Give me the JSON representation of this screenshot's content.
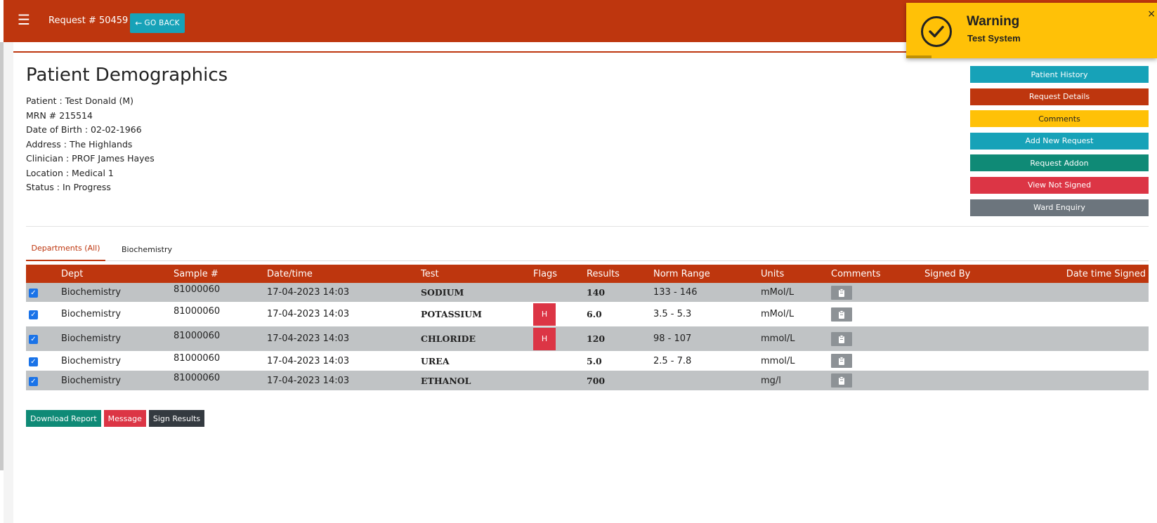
{
  "header": {
    "menu_icon": "hamburger-icon",
    "request_title": "Request # 50459",
    "go_back_label": "GO BACK",
    "go_back_icon": "arrow-left-icon"
  },
  "demographics": {
    "title": "Patient Demographics",
    "lines": [
      "Patient : Test Donald (M)",
      "MRN # 215514",
      "Date of Birth : 02-02-1966",
      "Address : The Highlands",
      "Clinician : PROF James Hayes",
      "Location : Medical 1",
      "Status : In Progress"
    ]
  },
  "side_buttons": [
    {
      "label": "Patient History",
      "color": "#17a2b8"
    },
    {
      "label": "Request Details",
      "color": "#be360e"
    },
    {
      "label": "Comments",
      "color": "#ffc107"
    },
    {
      "label": "Add New Request",
      "color": "#17a2b8"
    },
    {
      "label": "Request Addon",
      "color": "#0f8a76"
    },
    {
      "label": "View Not Signed",
      "color": "#dc3545"
    },
    {
      "label": "Ward Enquiry",
      "color": "#6c757d"
    }
  ],
  "tabs": [
    {
      "label": "Departments (All)",
      "active": true
    },
    {
      "label": "Biochemistry",
      "active": false
    }
  ],
  "table": {
    "headers": [
      "Dept",
      "Sample #",
      "Date/time",
      "Test",
      "Flags",
      "Results",
      "Norm Range",
      "Units",
      "Comments",
      "Signed By",
      "Date time Signed"
    ],
    "rows": [
      {
        "checked": true,
        "dept": "Biochemistry",
        "sample": "81000060",
        "datetime": "17-04-2023 14:03",
        "test": "SODIUM",
        "flag": "",
        "result": "140",
        "range": "133 - 146",
        "units": "mMol/L",
        "signed_by": "",
        "signed_at": ""
      },
      {
        "checked": true,
        "dept": "Biochemistry",
        "sample": "81000060",
        "datetime": "17-04-2023 14:03",
        "test": "POTASSIUM",
        "flag": "H",
        "result": "6.0",
        "range": "3.5 - 5.3",
        "units": "mMol/L",
        "signed_by": "",
        "signed_at": ""
      },
      {
        "checked": true,
        "dept": "Biochemistry",
        "sample": "81000060",
        "datetime": "17-04-2023 14:03",
        "test": "CHLORIDE",
        "flag": "H",
        "result": "120",
        "range": "98 - 107",
        "units": "mmol/L",
        "signed_by": "",
        "signed_at": ""
      },
      {
        "checked": true,
        "dept": "Biochemistry",
        "sample": "81000060",
        "datetime": "17-04-2023 14:03",
        "test": "UREA",
        "flag": "",
        "result": "5.0",
        "range": "2.5 - 7.8",
        "units": "mmol/L",
        "signed_by": "",
        "signed_at": ""
      },
      {
        "checked": true,
        "dept": "Biochemistry",
        "sample": "81000060",
        "datetime": "17-04-2023 14:03",
        "test": "ETHANOL",
        "flag": "",
        "result": "700",
        "range": "",
        "units": "mg/l",
        "signed_by": "",
        "signed_at": ""
      }
    ],
    "comment_icon": "clipboard-icon"
  },
  "bottom_buttons": [
    {
      "label": "Download Report",
      "color": "#0f8a76"
    },
    {
      "label": "Message",
      "color": "#dc3545"
    },
    {
      "label": "Sign Results",
      "color": "#343a40"
    }
  ],
  "toast": {
    "title": "Warning",
    "message": "Test System",
    "icon": "check-circle-icon",
    "close": "×",
    "color": "#ffc107"
  },
  "colors": {
    "brand": "#be360e",
    "row_gray": "#c0c3c5"
  }
}
